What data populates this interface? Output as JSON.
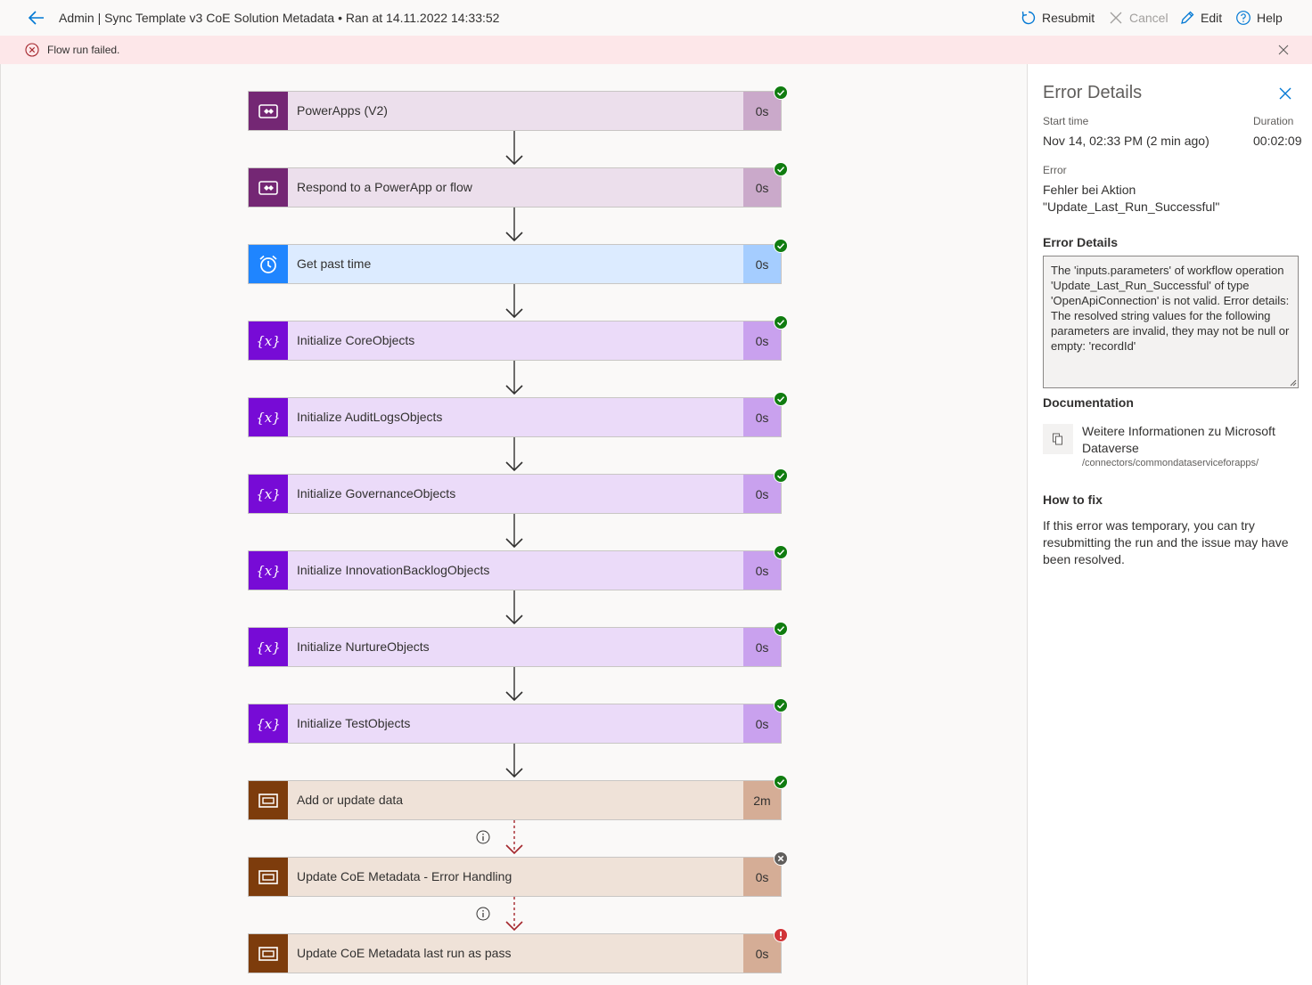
{
  "header": {
    "title": "Admin | Sync Template v3 CoE Solution Metadata • Ran at 14.11.2022 14:33:52",
    "resubmit": "Resubmit",
    "cancel": "Cancel",
    "edit": "Edit",
    "help": "Help"
  },
  "banner": {
    "message": "Flow run failed."
  },
  "steps": [
    {
      "label": "PowerApps (V2)",
      "duration": "0s",
      "kind": "powerapps",
      "status": "succeeded"
    },
    {
      "label": "Respond to a PowerApp or flow",
      "duration": "0s",
      "kind": "powerapps",
      "status": "succeeded"
    },
    {
      "label": "Get past time",
      "duration": "0s",
      "kind": "schedule",
      "status": "succeeded"
    },
    {
      "label": "Initialize CoreObjects",
      "duration": "0s",
      "kind": "variable",
      "status": "succeeded"
    },
    {
      "label": "Initialize AuditLogsObjects",
      "duration": "0s",
      "kind": "variable",
      "status": "succeeded"
    },
    {
      "label": "Initialize GovernanceObjects",
      "duration": "0s",
      "kind": "variable",
      "status": "succeeded"
    },
    {
      "label": "Initialize InnovationBacklogObjects",
      "duration": "0s",
      "kind": "variable",
      "status": "succeeded"
    },
    {
      "label": "Initialize NurtureObjects",
      "duration": "0s",
      "kind": "variable",
      "status": "succeeded"
    },
    {
      "label": "Initialize TestObjects",
      "duration": "0s",
      "kind": "variable",
      "status": "succeeded"
    },
    {
      "label": "Add or update data",
      "duration": "2m",
      "kind": "dataverse",
      "status": "succeeded"
    },
    {
      "label": "Update CoE Metadata - Error Handling",
      "duration": "0s",
      "kind": "dataverse",
      "status": "skipped"
    },
    {
      "label": "Update CoE Metadata last run as pass",
      "duration": "0s",
      "kind": "dataverse",
      "status": "failed"
    }
  ],
  "panel": {
    "title": "Error Details",
    "start_time_label": "Start time",
    "start_time": "Nov 14, 02:33 PM (2 min ago)",
    "duration_label": "Duration",
    "duration": "00:02:09",
    "error_label": "Error",
    "error_summary_line1": "Fehler bei Aktion",
    "error_summary_line2": "\"Update_Last_Run_Successful\"",
    "error_details_heading": "Error Details",
    "error_details_text": "The 'inputs.parameters' of workflow operation 'Update_Last_Run_Successful' of type 'OpenApiConnection' is not valid. Error details: The resolved string values for the following parameters are invalid, they may not be null or empty: 'recordId'",
    "documentation_heading": "Documentation",
    "doc_link": "Weitere Informationen zu Microsoft Dataverse",
    "doc_url": "/connectors/commondataserviceforapps/",
    "how_to_fix_heading": "How to fix",
    "how_to_fix_text": "If this error was temporary, you can try resubmitting the run and the issue may have been resolved."
  },
  "colors": {
    "powerapps": "#742774",
    "schedule": "#1f85ff",
    "variable": "#770bd6",
    "dataverse": "#7d3c0c",
    "success": "#107c10",
    "failed": "#d13438",
    "skipped": "#605e5c",
    "banner_bg": "#fde7e9",
    "accent": "#0078d4"
  }
}
